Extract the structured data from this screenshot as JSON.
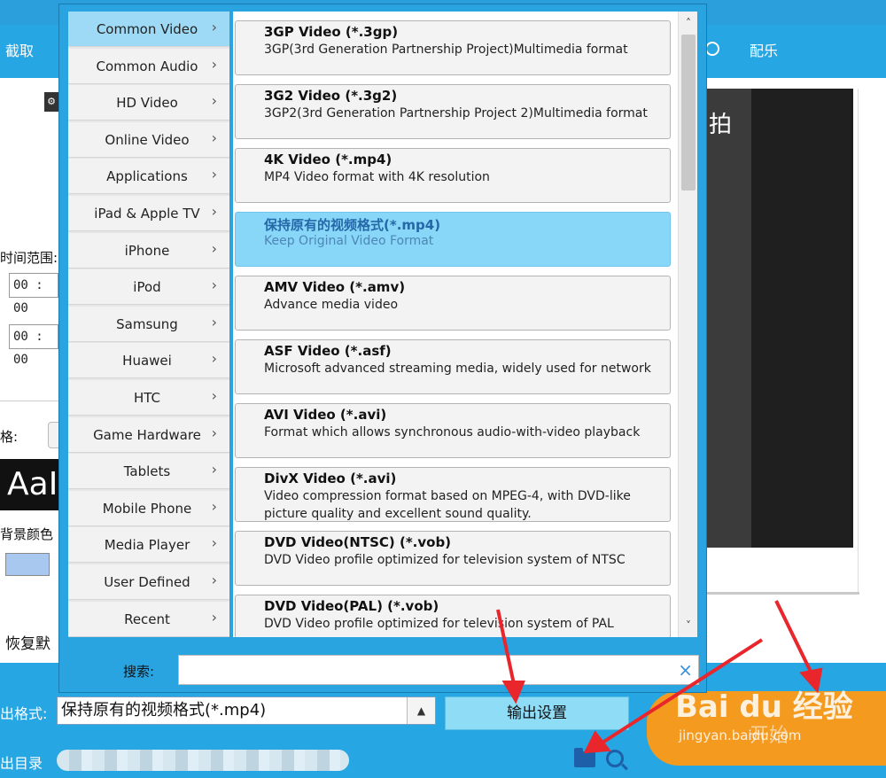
{
  "toolbar": {
    "crop_label": "截取",
    "music_label": "配乐"
  },
  "left_panel": {
    "time_range_label": "时间范围:",
    "start_time": "00 : 00",
    "end_time": "00 : 00",
    "format_label": "格:",
    "preview_text": "AaI",
    "bg_color_label": "背景颜色",
    "restore_label": "恢复默"
  },
  "preview": {
    "overlay_text": "拍"
  },
  "popup": {
    "categories": [
      {
        "label": "Common Video",
        "active": true
      },
      {
        "label": "Common Audio",
        "active": false
      },
      {
        "label": "HD Video",
        "active": false
      },
      {
        "label": "Online Video",
        "active": false
      },
      {
        "label": "Applications",
        "active": false
      },
      {
        "label": "iPad & Apple TV",
        "active": false
      },
      {
        "label": "iPhone",
        "active": false
      },
      {
        "label": "iPod",
        "active": false
      },
      {
        "label": "Samsung",
        "active": false
      },
      {
        "label": "Huawei",
        "active": false
      },
      {
        "label": "HTC",
        "active": false
      },
      {
        "label": "Game Hardware",
        "active": false
      },
      {
        "label": "Tablets",
        "active": false
      },
      {
        "label": "Mobile Phone",
        "active": false
      },
      {
        "label": "Media Player",
        "active": false
      },
      {
        "label": "User Defined",
        "active": false
      },
      {
        "label": "Recent",
        "active": false
      }
    ],
    "chevron": "›",
    "formats": [
      {
        "title": "3GP Video (*.3gp)",
        "desc": "3GP(3rd Generation Partnership Project)Multimedia format",
        "selected": false
      },
      {
        "title": "3G2 Video (*.3g2)",
        "desc": "3GP2(3rd Generation Partnership Project 2)Multimedia format",
        "selected": false
      },
      {
        "title": "4K Video (*.mp4)",
        "desc": "MP4 Video format with 4K resolution",
        "selected": false
      },
      {
        "title": "保持原有的视频格式(*.mp4)",
        "desc": "Keep Original Video Format",
        "selected": true
      },
      {
        "title": "AMV Video (*.amv)",
        "desc": "Advance media video",
        "selected": false
      },
      {
        "title": "ASF Video (*.asf)",
        "desc": "Microsoft advanced streaming media, widely used for network",
        "selected": false
      },
      {
        "title": "AVI Video (*.avi)",
        "desc": "Format which allows synchronous audio-with-video playback",
        "selected": false
      },
      {
        "title": "DivX Video (*.avi)",
        "desc": "Video compression format based on MPEG-4, with DVD-like picture quality and excellent sound quality.",
        "selected": false
      },
      {
        "title": "DVD Video(NTSC) (*.vob)",
        "desc": "DVD Video profile optimized for television system of NTSC",
        "selected": false
      },
      {
        "title": "DVD Video(PAL) (*.vob)",
        "desc": "DVD Video profile optimized for television system of PAL",
        "selected": false
      }
    ],
    "search_label": "搜索:",
    "search_value": "",
    "clear_glyph": "×",
    "scroll_up_glyph": "˄",
    "scroll_down_glyph": "˅"
  },
  "bottom": {
    "output_format_label": "出格式:",
    "output_format_value": "保持原有的视频格式(*.mp4)",
    "format_arrow": "▲",
    "output_settings_label": "输出设置",
    "output_dir_label": "出目录",
    "start_label": "开始",
    "watermark_brand": "Bai du 经验",
    "watermark_url": "jingyan.baidu.com"
  },
  "colors": {
    "accent_blue": "#26a6e3",
    "selected_blue": "#88d6f8",
    "start_orange": "#f39a1f",
    "arrow_red": "#e8262b"
  }
}
